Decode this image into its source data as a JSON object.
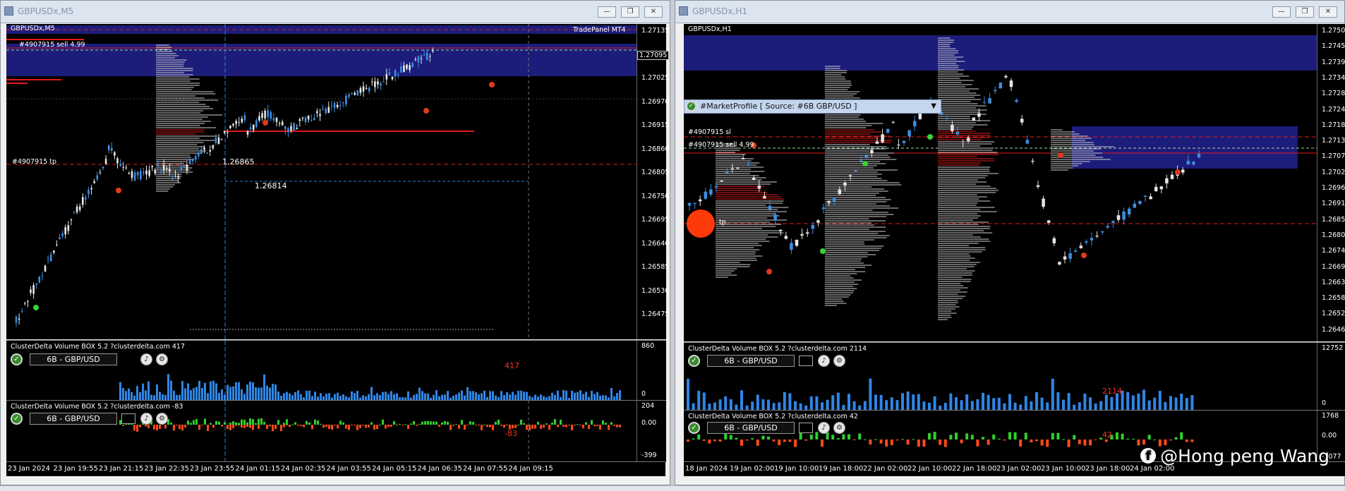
{
  "left": {
    "title": "GBPUSDx,M5",
    "chart_label": "GBPUSDx,M5",
    "trade_label": "#4907915 sell 4.99",
    "tp_label": "#4907915 tp",
    "tradepanel": "TradePanel MT4",
    "price_labels": [
      "1.26865",
      "1.26814"
    ],
    "price_axis": [
      "1.27135",
      "1.27080",
      "1.27025",
      "1.26970",
      "1.26915",
      "1.26860",
      "1.26805",
      "1.26750",
      "1.26695",
      "1.26640",
      "1.26585",
      "1.26530",
      "1.26475"
    ],
    "current_prices": [
      "1.27095"
    ],
    "ind1": {
      "title": "ClusterDelta Volume BOX 5.2 ?clusterdelta.com 417",
      "symbol": "6B - GBP/USD",
      "value": "417",
      "axis": [
        "860",
        "0"
      ]
    },
    "ind2": {
      "title": "ClusterDelta Volume BOX 5.2 ?clusterdelta.com -83",
      "symbol": "6B - GBP/USD",
      "value": "-83",
      "axis": [
        "204",
        "0.00",
        "-399"
      ]
    },
    "time_axis": [
      "23 Jan 2024",
      "23 Jan 19:55",
      "23 Jan 21:15",
      "23 Jan 22:35",
      "23 Jan 23:55",
      "24 Jan 01:15",
      "24 Jan 02:35",
      "24 Jan 03:55",
      "24 Jan 05:15",
      "24 Jan 06:35",
      "24 Jan 07:55",
      "24 Jan 09:15"
    ]
  },
  "right": {
    "title": "GBPUSDx,H1",
    "chart_label": "GBPUSDx,H1",
    "market_profile": "#MarketProfile [ Source: #6B GBP/USD ]",
    "sl_label": "#4907915 sl",
    "trade_label": "#4907915 sell 4.99",
    "tp_label": "tp",
    "price_axis": [
      "1.27505",
      "1.27450",
      "1.27395",
      "1.27340",
      "1.27285",
      "1.27240",
      "1.27185",
      "1.27130",
      "1.27075",
      "1.27020",
      "1.26965",
      "1.26910",
      "1.26855",
      "1.26800",
      "1.26745",
      "1.26690",
      "1.26635",
      "1.26580",
      "1.26525",
      "1.26465"
    ],
    "ind1": {
      "title": "ClusterDelta Volume BOX 5.2 ?clusterdelta.com 2114",
      "symbol": "6B - GBP/USD",
      "value": "2114",
      "axis": [
        "12752",
        "0"
      ]
    },
    "ind2": {
      "title": "ClusterDelta Volume BOX 5.2 ?clusterdelta.com 42",
      "symbol": "6B - GBP/USD",
      "value": "42",
      "axis": [
        "1768",
        "0.00",
        "-1077"
      ]
    },
    "time_axis": [
      "18 Jan 2024",
      "19 Jan 02:00",
      "19 Jan 10:00",
      "19 Jan 18:00",
      "22 Jan 02:00",
      "22 Jan 10:00",
      "22 Jan 18:00",
      "23 Jan 02:00",
      "23 Jan 10:00",
      "23 Jan 18:00",
      "24 Jan 02:00"
    ]
  },
  "watermark": "@Hong peng Wang",
  "window_buttons": {
    "minimize": "—",
    "restore": "❐",
    "close": "✕"
  }
}
